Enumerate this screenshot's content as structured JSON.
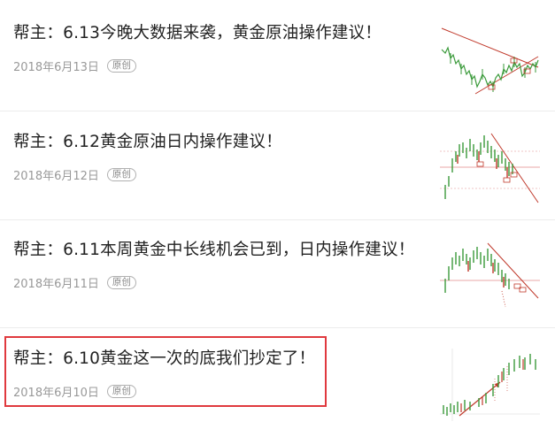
{
  "articles": [
    {
      "title": "帮主：6.13今晚大数据来袭，黄金原油操作建议！",
      "date": "2018年6月13日",
      "badge": "原创"
    },
    {
      "title": "帮主：6.12黄金原油日内操作建议！",
      "date": "2018年6月12日",
      "badge": "原创"
    },
    {
      "title": "帮主：6.11本周黄金中长线机会已到，日内操作建议！",
      "date": "2018年6月11日",
      "badge": "原创"
    },
    {
      "title": "帮主：6.10黄金这一次的底我们抄定了！",
      "date": "2018年6月10日",
      "badge": "原创"
    }
  ],
  "colors": {
    "highlight_border": "#e0393e",
    "candle_up": "#3a9a3a",
    "candle_down": "#c0392b",
    "trend_line": "#c0392b"
  }
}
